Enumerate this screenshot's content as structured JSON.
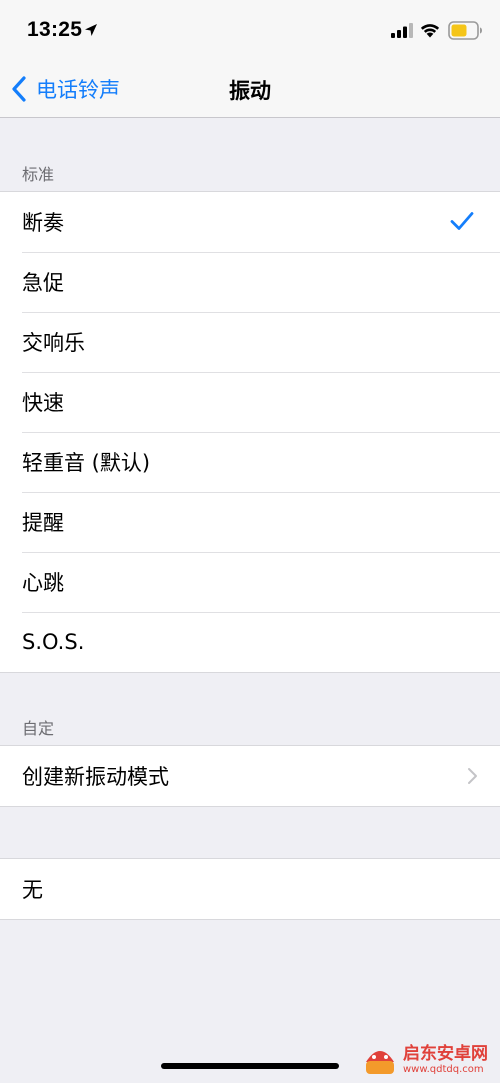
{
  "status_bar": {
    "time": "13:25"
  },
  "nav": {
    "back_label": "电话铃声",
    "title": "振动"
  },
  "standard": {
    "header": "标准",
    "items": [
      {
        "label": "断奏",
        "selected": true
      },
      {
        "label": "急促"
      },
      {
        "label": "交响乐"
      },
      {
        "label": "快速"
      },
      {
        "label": "轻重音 (默认)"
      },
      {
        "label": "提醒"
      },
      {
        "label": "心跳"
      },
      {
        "label": "S.O.S."
      }
    ]
  },
  "custom": {
    "header": "自定",
    "create_label": "创建新振动模式"
  },
  "none": {
    "label": "无"
  },
  "watermark": {
    "main": "启东安卓网",
    "sub": "www.qdtdq.com"
  },
  "colors": {
    "accent": "#147efb",
    "background": "#efeff4",
    "watermark": "#e0413a"
  }
}
